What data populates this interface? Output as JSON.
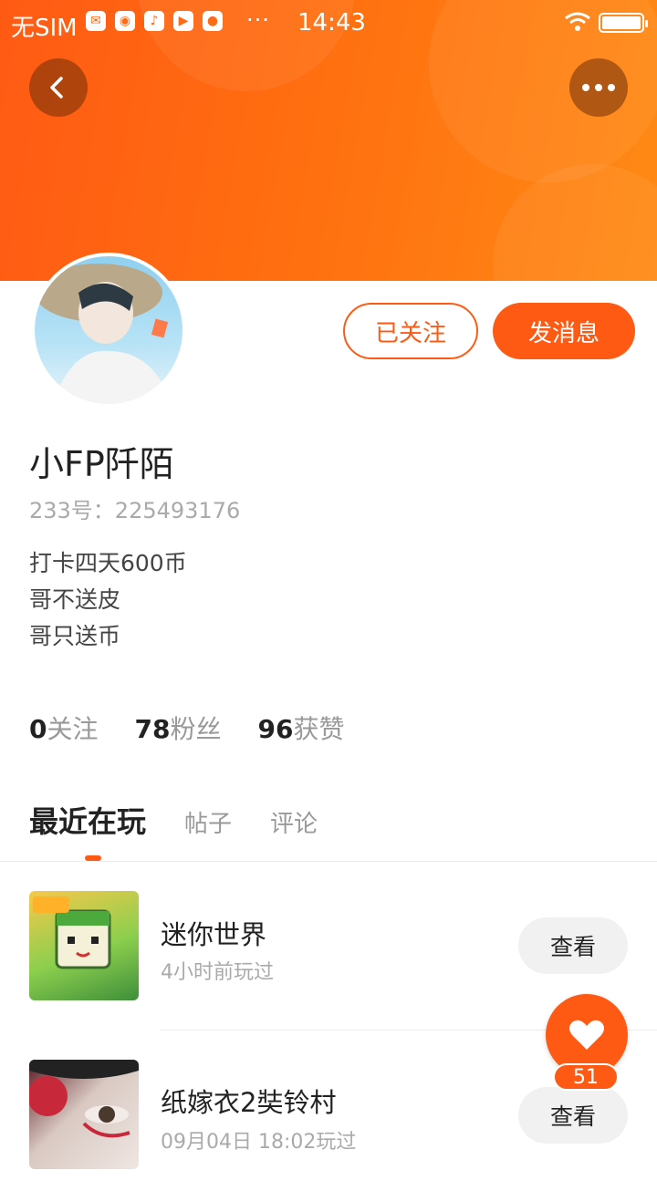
{
  "status_bar": {
    "carrier": "无SIM",
    "more": "···",
    "time": "14:43"
  },
  "colors": {
    "accent": "#ff5a14",
    "header_gradient_start": "#ff5a14",
    "header_gradient_end": "#ff8a14"
  },
  "nav": {
    "back_icon": "chevron-left-icon",
    "more_icon": "more-dots-icon"
  },
  "profile": {
    "name": "小FP阡陌",
    "uid": "233号：225493176",
    "bio": [
      "打卡四天600币",
      "哥不送皮",
      "哥只送币"
    ],
    "follow_label": "已关注",
    "message_label": "发消息"
  },
  "stats": [
    {
      "num": "0",
      "label": "关注"
    },
    {
      "num": "78",
      "label": "粉丝"
    },
    {
      "num": "96",
      "label": "获赞"
    }
  ],
  "tabs": [
    "最近在玩",
    "帖子",
    "评论"
  ],
  "games": [
    {
      "title": "迷你世界",
      "meta": "4小时前玩过",
      "action": "查看"
    },
    {
      "title": "纸嫁衣2奘铃村",
      "meta": "09月04日 18:02玩过",
      "action": "查看"
    }
  ],
  "like_fab": {
    "icon": "heart-icon",
    "count": "51"
  }
}
